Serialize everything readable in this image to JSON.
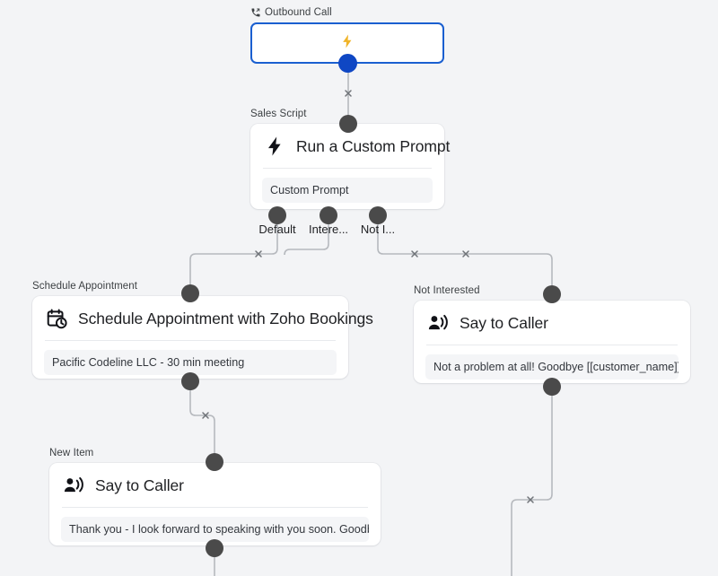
{
  "canvas": {
    "background": "#f3f4f6",
    "edge_color": "#b6b9be",
    "handle_color": "#4a4a4a",
    "trigger_border_color": "#1a5fd0",
    "trigger_handle_color": "#0f47c4",
    "bolt_color": "#f0b429"
  },
  "nodes": {
    "outbound_call": {
      "label": "Outbound Call",
      "label_icon": "outbound-call-icon",
      "body_icon": "lightning-bolt-icon"
    },
    "sales_script": {
      "label": "Sales Script",
      "title": "Run a Custom Prompt",
      "icon": "lightning-bolt-icon",
      "field": "Custom Prompt",
      "outputs": [
        {
          "name": "Default"
        },
        {
          "name": "Intere..."
        },
        {
          "name": "Not I..."
        }
      ]
    },
    "schedule_appointment": {
      "label": "Schedule Appointment",
      "title": "Schedule Appointment with Zoho Bookings",
      "icon": "calendar-clock-icon",
      "field": "Pacific Codeline LLC - 30 min meeting"
    },
    "not_interested": {
      "label": "Not Interested",
      "title": "Say to Caller",
      "icon": "say-to-caller-icon",
      "field": "Not a problem at all! Goodbye [[customer_name]] !"
    },
    "new_item": {
      "label": "New Item",
      "title": "Say to Caller",
      "icon": "say-to-caller-icon",
      "field": "Thank you - I look forward to speaking with you soon. Goodbye!"
    }
  },
  "edges": [
    {
      "id": "trigger-to-sales-script",
      "delete_icon": "close-icon"
    },
    {
      "id": "default-to-schedule-appointment",
      "delete_icon": "close-icon"
    },
    {
      "id": "interested-to-schedule-appointment",
      "delete_icon": "close-icon"
    },
    {
      "id": "not-interested-to-say-to-caller",
      "delete_icon": "close-icon"
    },
    {
      "id": "schedule-appointment-to-new-item",
      "delete_icon": "close-icon"
    },
    {
      "id": "not-interested-say-to-caller-out",
      "delete_icon": "close-icon"
    }
  ]
}
